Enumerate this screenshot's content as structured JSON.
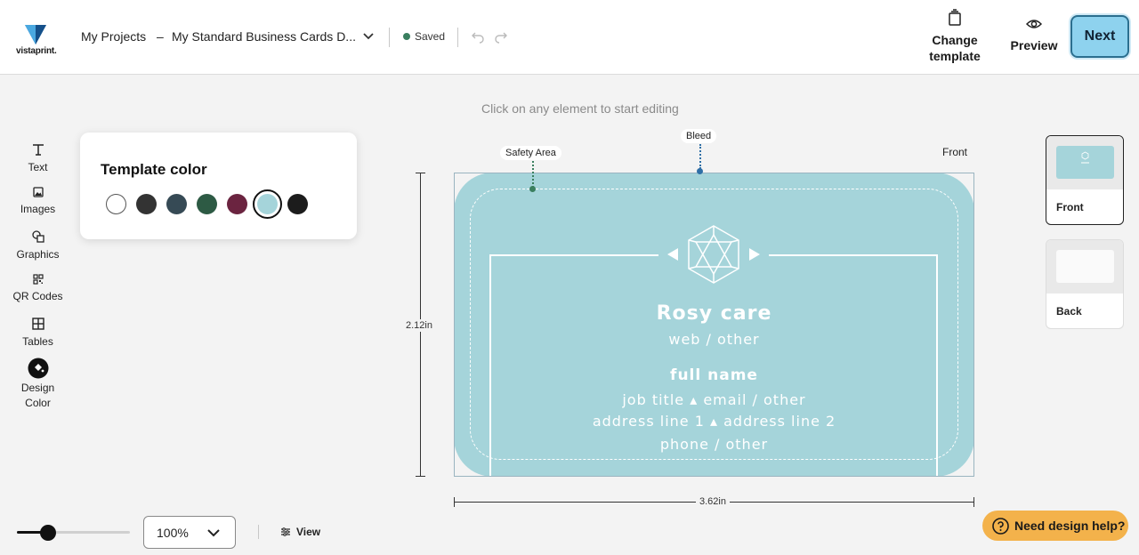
{
  "header": {
    "logo_text": "vistaprint.",
    "my_projects": "My Projects",
    "separator": "–",
    "project_name": "My Standard Business Cards D...",
    "saved_status": "Saved",
    "change_template_line1": "Change",
    "change_template_line2": "template",
    "preview_label": "Preview",
    "next_label": "Next"
  },
  "hint": "Click on any element to start editing",
  "rail": [
    {
      "label": "Text",
      "icon": "text-icon"
    },
    {
      "label": "Images",
      "icon": "image-icon"
    },
    {
      "label": "Graphics",
      "icon": "shapes-icon"
    },
    {
      "label": "QR Codes",
      "icon": "qr-code-icon"
    },
    {
      "label": "Tables",
      "icon": "table-icon"
    },
    {
      "label_line1": "Design",
      "label_line2": "Color",
      "icon": "paint-bucket-icon"
    }
  ],
  "template_color": {
    "title": "Template color",
    "swatches": [
      "#ffffff",
      "#333333",
      "#364a55",
      "#2d5a44",
      "#6b2440",
      "#a5d4da",
      "#1c1c1c"
    ],
    "selected_index": 5
  },
  "canvas": {
    "safety_area_label": "Safety Area",
    "bleed_label": "Bleed",
    "side_label": "Front",
    "height_label": "2.12in",
    "width_label": "3.62in",
    "card_color": "#a5d4da"
  },
  "card": {
    "company": "Rosy care",
    "web": "web / other",
    "full_name": "full name",
    "line_job": "job title ▴ email / other",
    "line_address": "address line 1 ▴ address line 2",
    "line_phone": "phone / other"
  },
  "sides": [
    {
      "label": "Front",
      "active": true
    },
    {
      "label": "Back",
      "active": false
    }
  ],
  "bottom": {
    "zoom_value": "100%",
    "zoom_level": 0.27,
    "view_label": "View",
    "help_label": "Need design help?"
  },
  "colors": {
    "accent": "#8ed2ee",
    "help": "#f3b24b",
    "safety_guide": "#3a7f5f",
    "bleed_guide": "#2f6fa6"
  }
}
